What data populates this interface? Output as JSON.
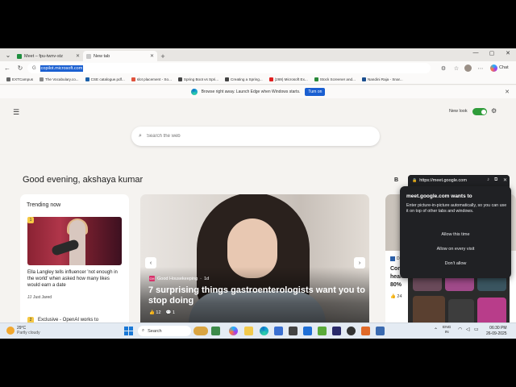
{
  "tabs": [
    {
      "label": "Meet – fpu-twnv-stz",
      "active": false,
      "favicon_color": "#1e8e3e"
    },
    {
      "label": "New tab",
      "active": true,
      "favicon_color": "#bbbbbb"
    }
  ],
  "address": {
    "url": "copilot.microsoft.com"
  },
  "bookmarks": [
    {
      "label": "EXTCampus",
      "color": "#2b6fd6"
    },
    {
      "label": "The Vocabulary.co...",
      "color": "#888888"
    },
    {
      "label": "CSE catalogue.pdf...",
      "color": "#1a5fa8"
    },
    {
      "label": "slot placement - So...",
      "color": "#e0533d"
    },
    {
      "label": "Spring Boot vs Spri...",
      "color": "#444444"
    },
    {
      "label": "Creating a Spring...",
      "color": "#444444"
    },
    {
      "label": "(269) Microsoft Ex...",
      "color": "#e02020"
    },
    {
      "label": "Stock Screener and...",
      "color": "#2a8a3a"
    },
    {
      "label": "Nandini Raja - Snar...",
      "color": "#1b4f8f"
    }
  ],
  "notification": {
    "text": "Browse right away. Launch Edge when Windows starts.",
    "button": "Turn on"
  },
  "toolbar": {
    "chat_label": "Chat"
  },
  "ntp": {
    "new_look_label": "New look",
    "search_placeholder": "Search the web",
    "greeting": "Good evening, akshaya kumar",
    "trending": {
      "title": "Trending now",
      "items": [
        {
          "rank": "1",
          "headline": "Ella Langley tells influencer 'not enough in the world' when asked how many likes would earn a date",
          "source": "Just Jared"
        },
        {
          "rank": "2",
          "headline": "Exclusive - OpenAI works to"
        }
      ]
    },
    "hero": {
      "source": "Good Housekeeping",
      "age": "1d",
      "title": "7 surprising things gastroenterologists want you to stop doing",
      "likes": "12",
      "comments": "1"
    },
    "right_card": {
      "source": "Daily",
      "text": "Comb health in 80%",
      "likes": "24",
      "fragment": "B"
    }
  },
  "pip": {
    "url": "https://meet.google.com",
    "dialog": {
      "title": "meet.google.com wants to",
      "body": "Enter picture-in-picture automatically, so you can use it on top of other tabs and windows.",
      "buttons": [
        "Allow this time",
        "Allow on every visit",
        "Don't allow"
      ]
    }
  },
  "taskbar": {
    "weather_temp": "29°C",
    "weather_desc": "Partly cloudy",
    "search_label": "Search",
    "lang": "ENG",
    "lang_sub": "IN",
    "time": "06:30 PM",
    "date": "26-09-2025"
  }
}
